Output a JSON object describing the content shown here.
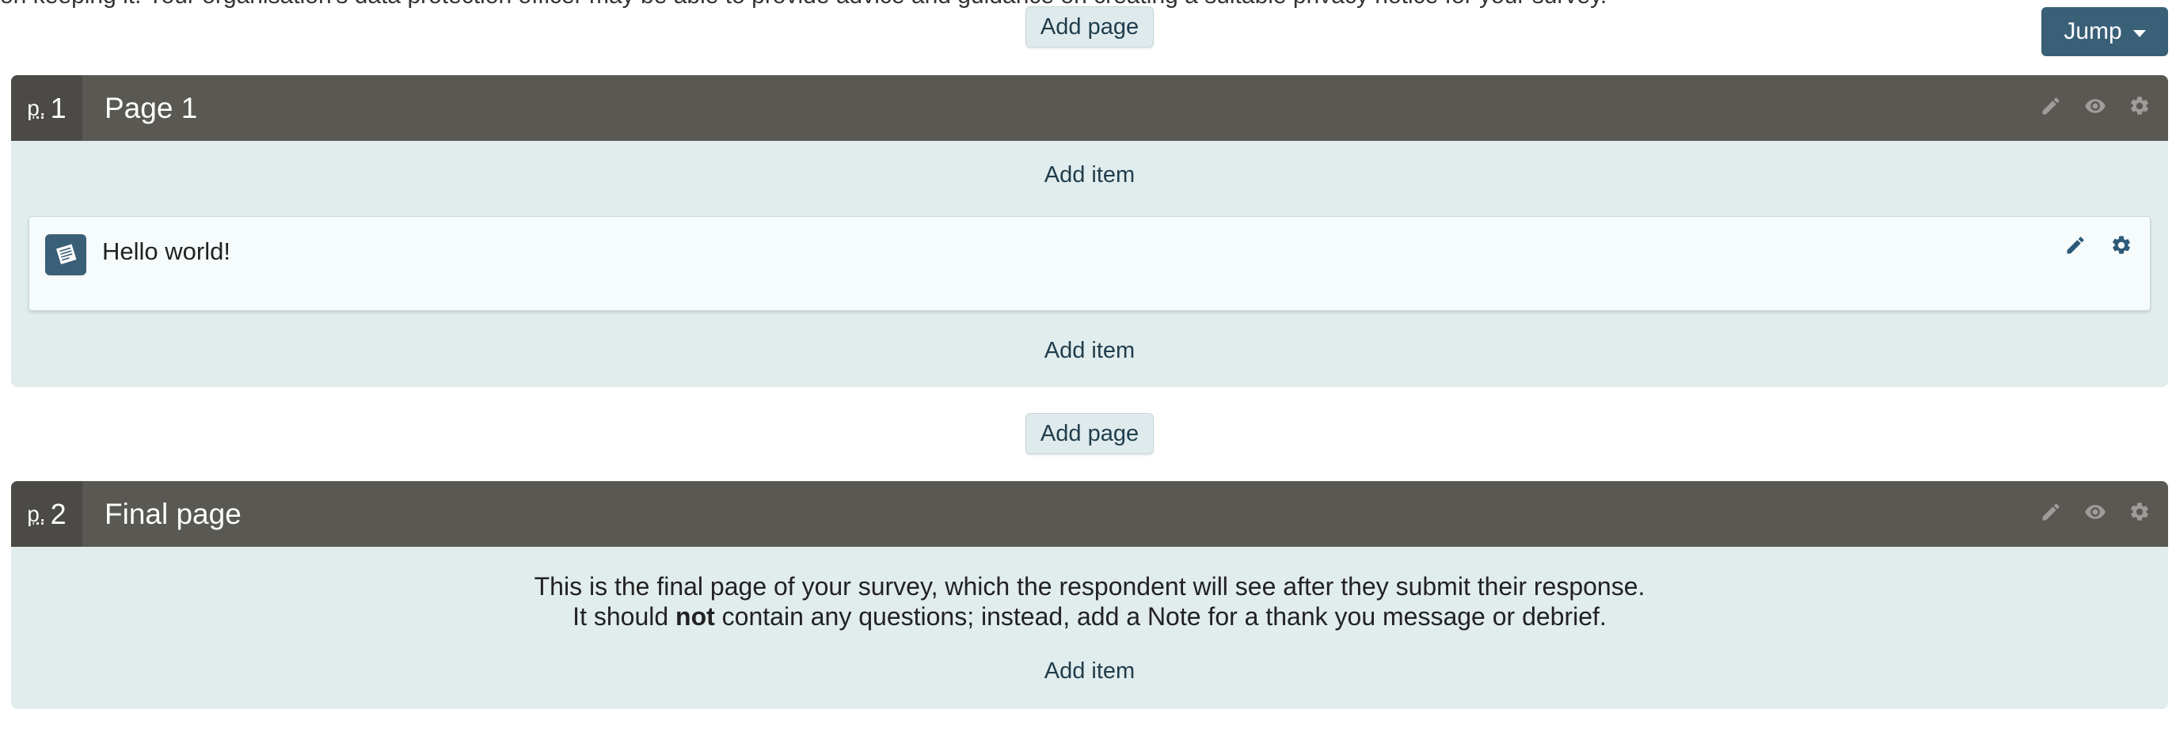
{
  "cutoff_text": "on keeping it. Your organisation's data protection officer may be able to provide advice and guidance on creating a suitable privacy notice for your survey.",
  "toolbar": {
    "add_page_label": "Add page",
    "jump_label": "Jump"
  },
  "pages": [
    {
      "abbr": "p.",
      "number": "1",
      "title": "Page 1",
      "add_item_label": "Add item",
      "items": [
        {
          "type_icon": "note-icon",
          "text": "Hello world!"
        }
      ]
    },
    {
      "abbr": "p.",
      "number": "2",
      "title": "Final page",
      "add_item_label": "Add item",
      "description_line1": "This is the final page of your survey, which the respondent will see after they submit their response.",
      "description_line2_pre": "It should ",
      "description_line2_bold": "not",
      "description_line2_post": " contain any questions; instead, add a Note for a thank you message or debrief."
    }
  ],
  "icons": {
    "edit": "pencil-icon",
    "preview": "eye-icon",
    "settings": "gear-icon"
  },
  "colors": {
    "header_bg": "#5a5853",
    "panel_bg": "#e1eced",
    "jump_bg": "#3a6078",
    "accent_icon": "#2c5a78"
  }
}
